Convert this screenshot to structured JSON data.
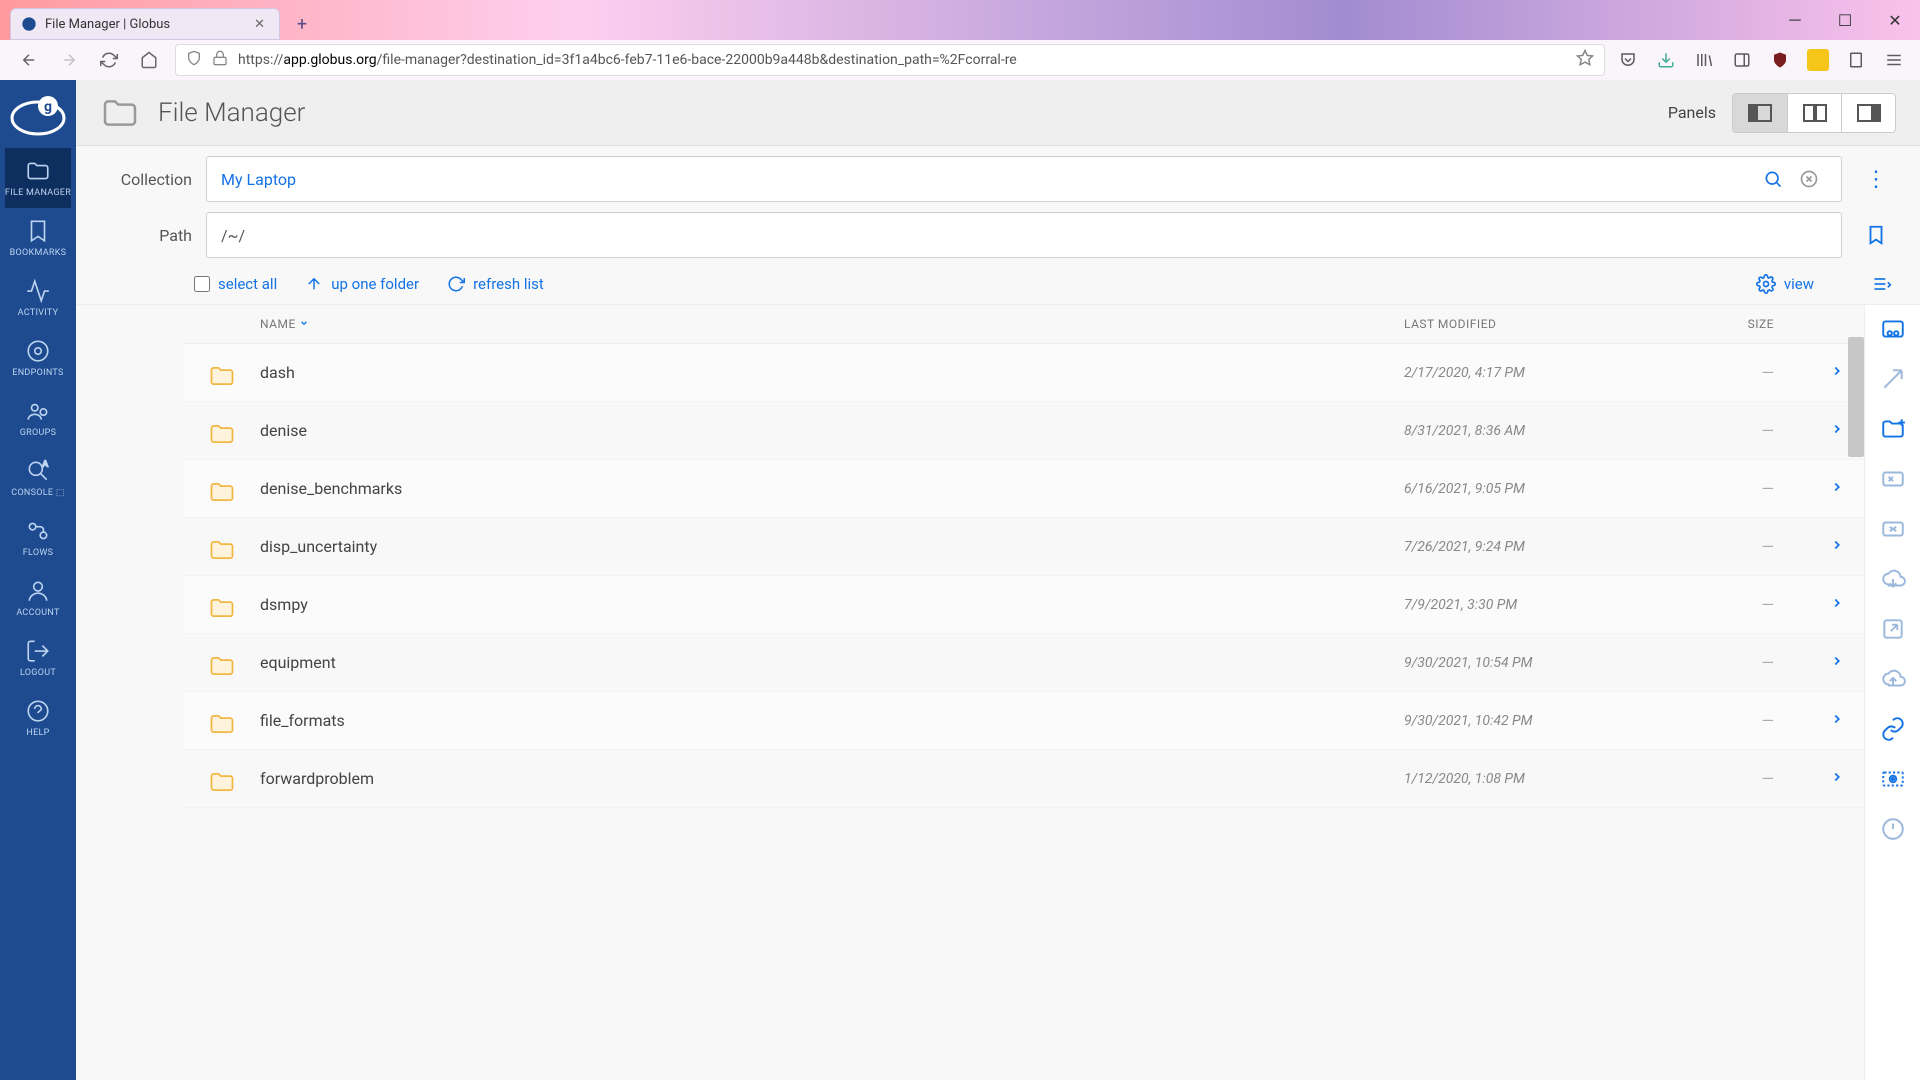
{
  "browser": {
    "tab_title": "File Manager | Globus",
    "url_prefix": "https://",
    "url_domain": "app.globus.org",
    "url_path": "/file-manager?destination_id=3f1a4bc6-feb7-11e6-bace-22000b9a448b&destination_path=%2Fcorral-re"
  },
  "sidebar": {
    "items": [
      {
        "label": "FILE MANAGER",
        "active": true
      },
      {
        "label": "BOOKMARKS"
      },
      {
        "label": "ACTIVITY"
      },
      {
        "label": "ENDPOINTS"
      },
      {
        "label": "GROUPS"
      },
      {
        "label": "CONSOLE ⬚"
      },
      {
        "label": "FLOWS"
      },
      {
        "label": "ACCOUNT"
      },
      {
        "label": "LOGOUT"
      },
      {
        "label": "HELP"
      }
    ]
  },
  "header": {
    "title": "File Manager",
    "panels_label": "Panels"
  },
  "collection": {
    "label": "Collection",
    "value": "My Laptop"
  },
  "path": {
    "label": "Path",
    "value": "/~/"
  },
  "toolbar": {
    "select_all": "select all",
    "up_one": "up one folder",
    "refresh": "refresh list",
    "view": "view"
  },
  "columns": {
    "name": "NAME",
    "modified": "LAST MODIFIED",
    "size": "SIZE"
  },
  "files": [
    {
      "name": "dash",
      "modified": "2/17/2020, 4:17 PM",
      "size": "—"
    },
    {
      "name": "denise",
      "modified": "8/31/2021, 8:36 AM",
      "size": "—"
    },
    {
      "name": "denise_benchmarks",
      "modified": "6/16/2021, 9:05 PM",
      "size": "—"
    },
    {
      "name": "disp_uncertainty",
      "modified": "7/26/2021, 9:24 PM",
      "size": "—"
    },
    {
      "name": "dsmpy",
      "modified": "7/9/2021, 3:30 PM",
      "size": "—"
    },
    {
      "name": "equipment",
      "modified": "9/30/2021, 10:54 PM",
      "size": "—"
    },
    {
      "name": "file_formats",
      "modified": "9/30/2021, 10:42 PM",
      "size": "—"
    },
    {
      "name": "forwardproblem",
      "modified": "1/12/2020, 1:08 PM",
      "size": "—"
    }
  ]
}
